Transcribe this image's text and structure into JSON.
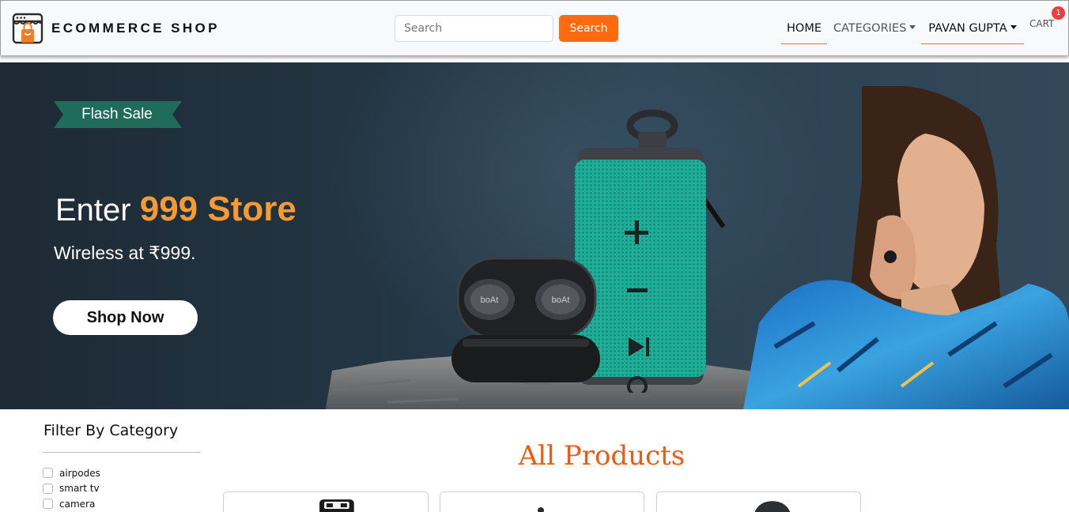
{
  "brand": {
    "name": "ECOMMERCE SHOP",
    "logo_icon": "shop-bag-icon"
  },
  "search": {
    "placeholder": "Search",
    "button_label": "Search"
  },
  "nav": {
    "home": "HOME",
    "categories": "CATEGORIES",
    "user": "PAVAN GUPTA",
    "cart": "CART",
    "cart_count": "1"
  },
  "banner": {
    "tag": "Flash Sale",
    "headline_prefix": "Enter ",
    "headline_accent": "999 Store",
    "subheadline": "Wireless at ₹999.",
    "cta": "Shop Now",
    "product_brand": "boAt"
  },
  "filter": {
    "title": "Filter By Category",
    "categories": [
      {
        "label": "airpodes",
        "checked": false
      },
      {
        "label": "smart tv",
        "checked": false
      },
      {
        "label": "camera",
        "checked": false
      }
    ]
  },
  "products": {
    "title": "All Products"
  },
  "colors": {
    "accent": "#fd6a0f",
    "title_orange": "#ee5a0e",
    "badge_red": "#ef3d3d",
    "banner_bg": "#233543",
    "banner_accent": "#f79a32",
    "ribbon_green": "#1f6b5c"
  }
}
